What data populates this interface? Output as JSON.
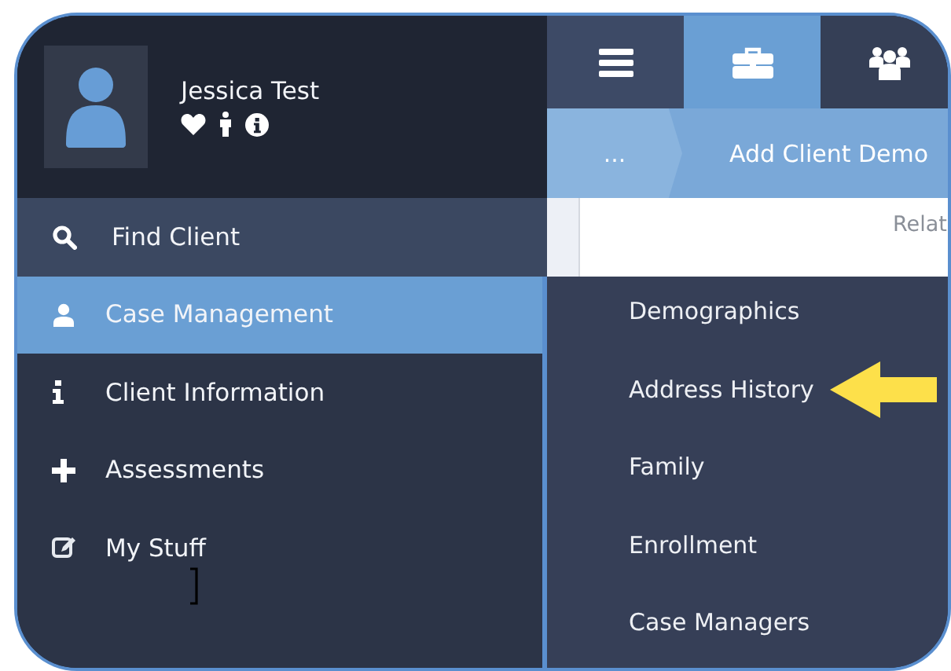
{
  "user": {
    "name": "Jessica Test",
    "badges": [
      {
        "kind": "heart"
      },
      {
        "kind": "person"
      },
      {
        "kind": "info"
      }
    ]
  },
  "nav": [
    {
      "label": "Find Client",
      "kind": "search",
      "selected": false
    },
    {
      "label": "Case Management",
      "kind": "user",
      "selected": true
    },
    {
      "label": "Client Information",
      "kind": "info",
      "selected": false
    },
    {
      "label": "Assessments",
      "kind": "plus",
      "selected": false
    },
    {
      "label": "My Stuff",
      "kind": "edit",
      "selected": false
    }
  ],
  "tabs": [
    {
      "kind": "menu",
      "selected": false
    },
    {
      "kind": "briefcase",
      "selected": true
    },
    {
      "kind": "people",
      "selected": false
    }
  ],
  "breadcrumb": [
    {
      "label": "..."
    },
    {
      "label": "Add Client Demo"
    }
  ],
  "content": {
    "header_text": "Relat"
  },
  "submenu": [
    {
      "label": "Demographics",
      "pointed": false
    },
    {
      "label": "Address History",
      "pointed": true
    },
    {
      "label": "Family",
      "pointed": false
    },
    {
      "label": "Enrollment",
      "pointed": false
    },
    {
      "label": "Case Managers",
      "pointed": false
    }
  ],
  "cursor": {
    "kind": "text"
  }
}
